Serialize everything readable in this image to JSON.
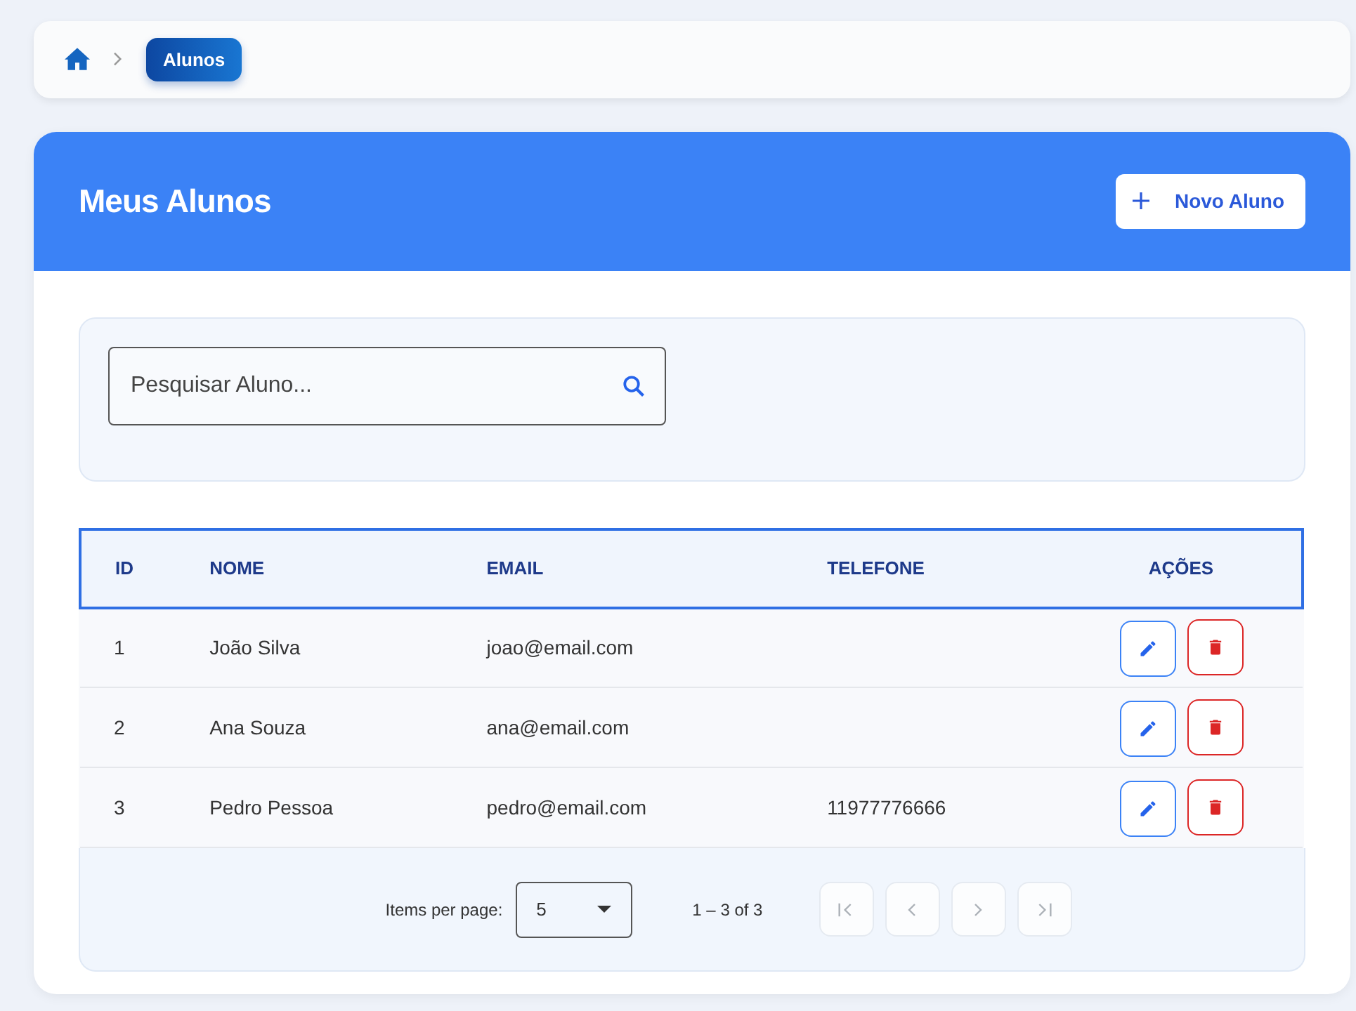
{
  "breadcrumb": {
    "current": "Alunos"
  },
  "header": {
    "title": "Meus Alunos",
    "button": "Novo Aluno"
  },
  "search": {
    "placeholder": "Pesquisar Aluno..."
  },
  "table": {
    "columns": [
      "ID",
      "NOME",
      "EMAIL",
      "TELEFONE",
      "AÇÕES"
    ],
    "rows": [
      {
        "id": "1",
        "name": "João Silva",
        "email": "joao@email.com",
        "phone": ""
      },
      {
        "id": "2",
        "name": "Ana Souza",
        "email": "ana@email.com",
        "phone": ""
      },
      {
        "id": "3",
        "name": "Pedro Pessoa",
        "email": "pedro@email.com",
        "phone": "11977776666"
      }
    ]
  },
  "paginator": {
    "label": "Items per page:",
    "page_size": "5",
    "range": "1 – 3 of 3",
    "buttons": [
      {
        "kind": "first",
        "disabled": true
      },
      {
        "kind": "prev",
        "disabled": true
      },
      {
        "kind": "next",
        "disabled": true
      },
      {
        "kind": "last",
        "disabled": true
      }
    ]
  }
}
